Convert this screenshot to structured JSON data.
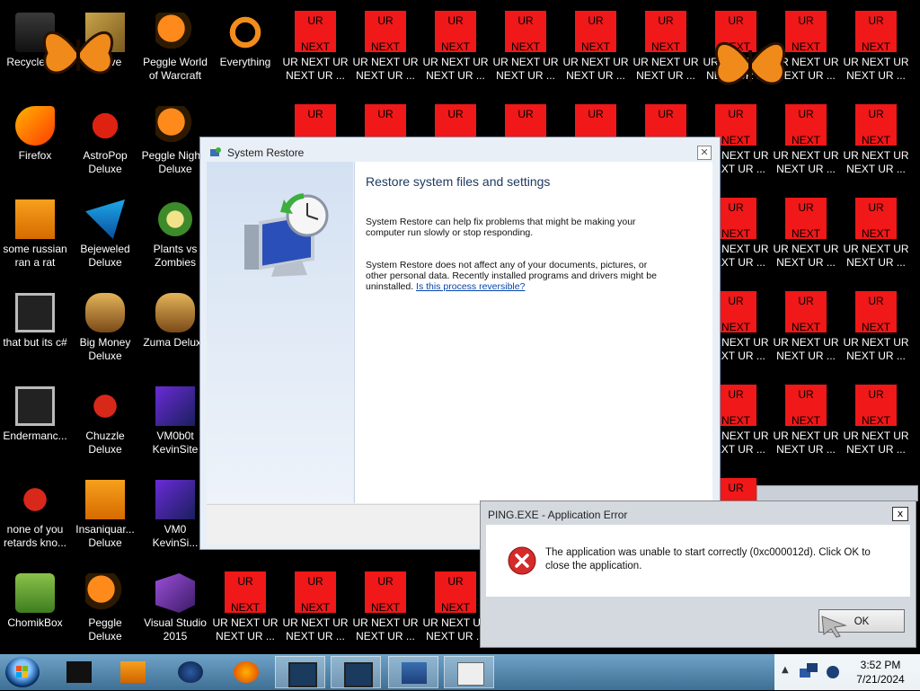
{
  "desktop": {
    "icons": [
      {
        "label": "Recycle Bin"
      },
      {
        "label": "Peggle World of Warcraft"
      },
      {
        "label": "Everything"
      },
      {
        "label": "Firefox"
      },
      {
        "label": "AstroPop Deluxe"
      },
      {
        "label": "Peggle Nights Deluxe"
      },
      {
        "label": "some russian ran a rat"
      },
      {
        "label": "Bejeweled Deluxe"
      },
      {
        "label": "Plants vs Zombies"
      },
      {
        "label": "that but its c#"
      },
      {
        "label": "Big Money Deluxe"
      },
      {
        "label": "Zuma Deluxe"
      },
      {
        "label": "Endermanc..."
      },
      {
        "label": "Chuzzle Deluxe"
      },
      {
        "label": "VM0b0t KevinSite"
      },
      {
        "label": "none of you retards kno..."
      },
      {
        "label": "Insaniquar... Deluxe"
      },
      {
        "label": "VM0 KevinSi..."
      },
      {
        "label": "ChomikBox"
      },
      {
        "label": "Peggle Deluxe"
      },
      {
        "label": "Visual Studio 2015"
      },
      {
        "label": "Wi...ve"
      }
    ],
    "ur_tile": {
      "top_text": "UR",
      "bottom_text": "NEXT",
      "label": "UR NEXT UR NEXT UR ..."
    }
  },
  "system_restore": {
    "title": "System Restore",
    "heading": "Restore system files and settings",
    "para1": "System Restore can help fix problems that might be making your computer run slowly or stop responding.",
    "para2": "System Restore does not affect any of your documents, pictures, or other personal data. Recently installed programs and drivers might be uninstalled.",
    "link": "Is this process reversible?"
  },
  "error_dialog": {
    "title": "PING.EXE - Application Error",
    "message": "The application was unable to start correctly (0xc000012d). Click OK to close the application.",
    "ok_label": "OK",
    "close_label": "x"
  },
  "taskbar": {
    "time": "3:52 PM",
    "date": "7/21/2024"
  },
  "colors": {
    "ur_tile_bg": "#f01818",
    "taskbar": "#4f7fa5"
  },
  "icons": {
    "start": "windows-orb-icon",
    "error": "error-x-icon",
    "restore": "system-restore-icon"
  }
}
